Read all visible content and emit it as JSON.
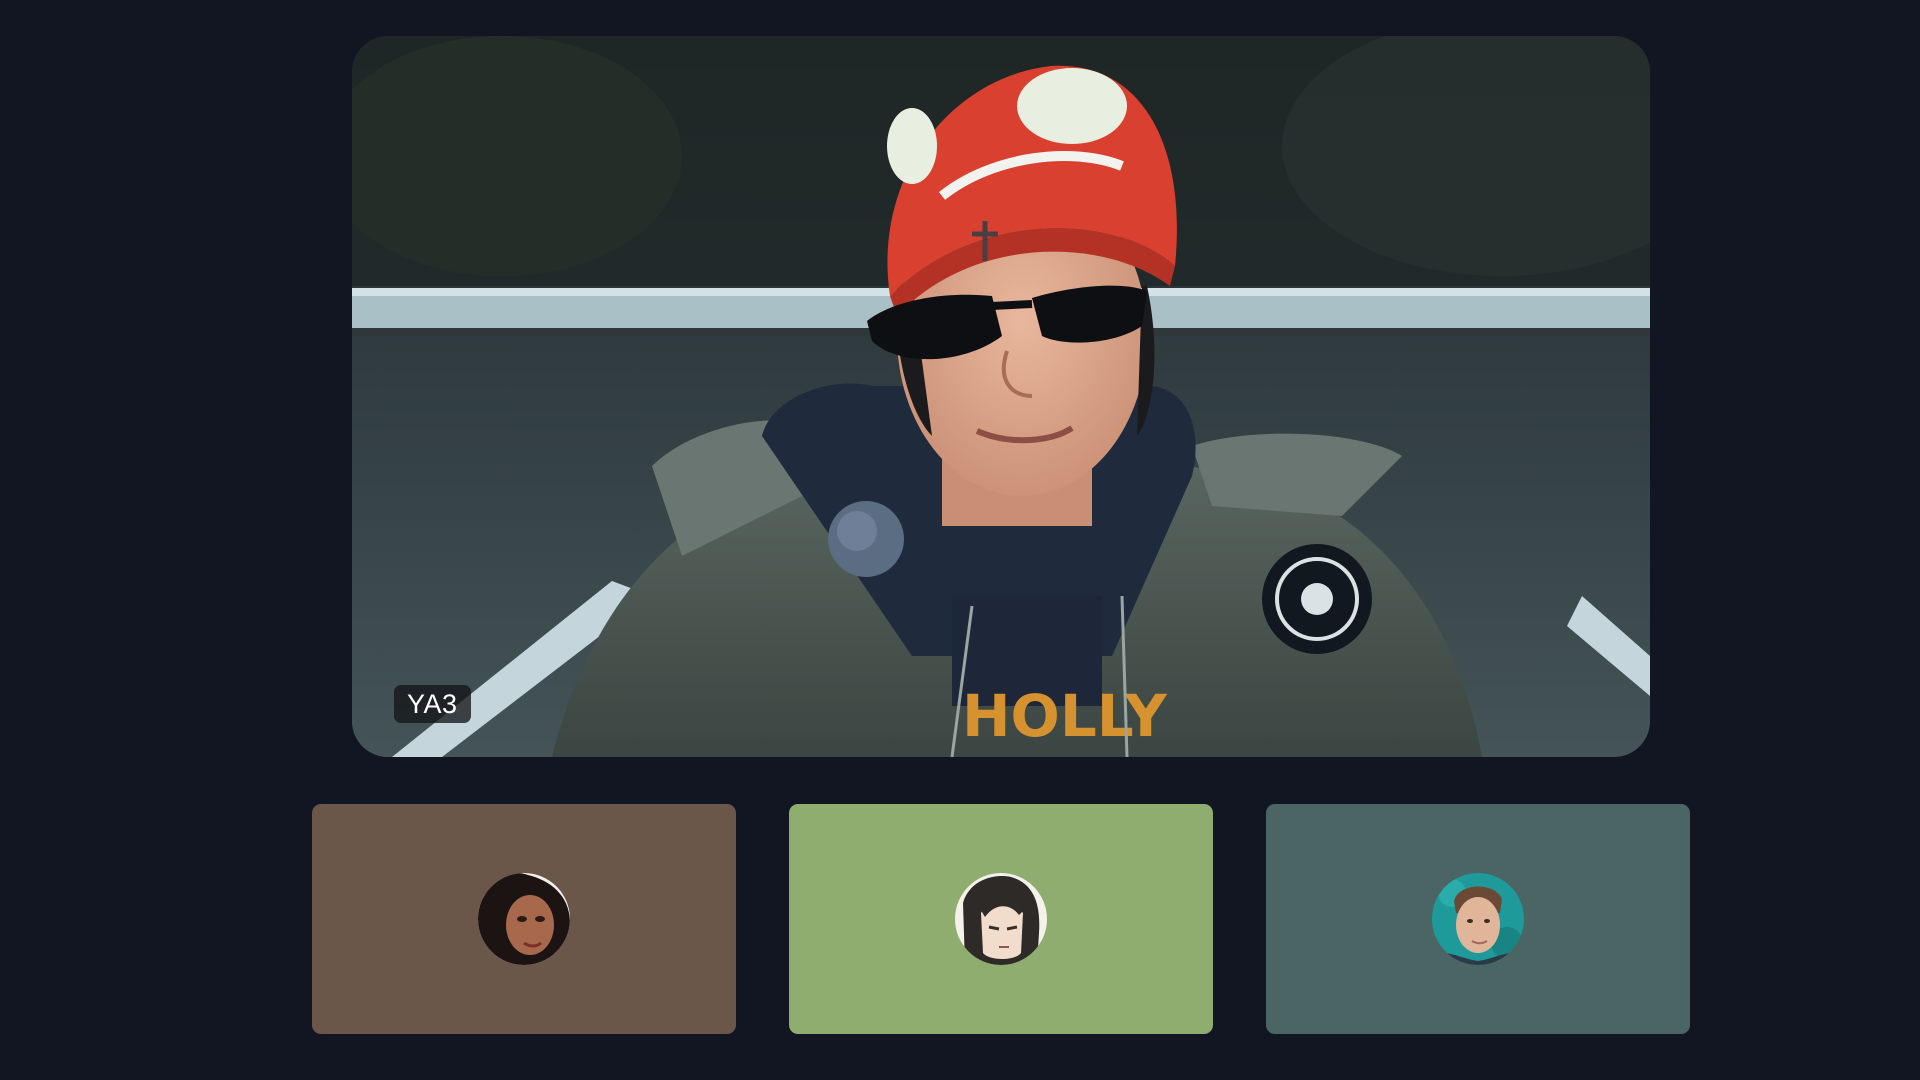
{
  "call": {
    "active_speaker": {
      "name": "YA3",
      "video": "person-in-red-beanie-and-sunglasses"
    },
    "participants": [
      {
        "avatar": "portrait-dark-hair-avatar",
        "tile_color": "#6b5749"
      },
      {
        "avatar": "anime-character-avatar",
        "tile_color": "#8ead6e"
      },
      {
        "avatar": "man-teal-background-avatar",
        "tile_color": "#4b6564"
      }
    ]
  },
  "colors": {
    "background": "#121622",
    "name_tag_bg": "#14161a",
    "name_tag_text": "#ffffff"
  }
}
